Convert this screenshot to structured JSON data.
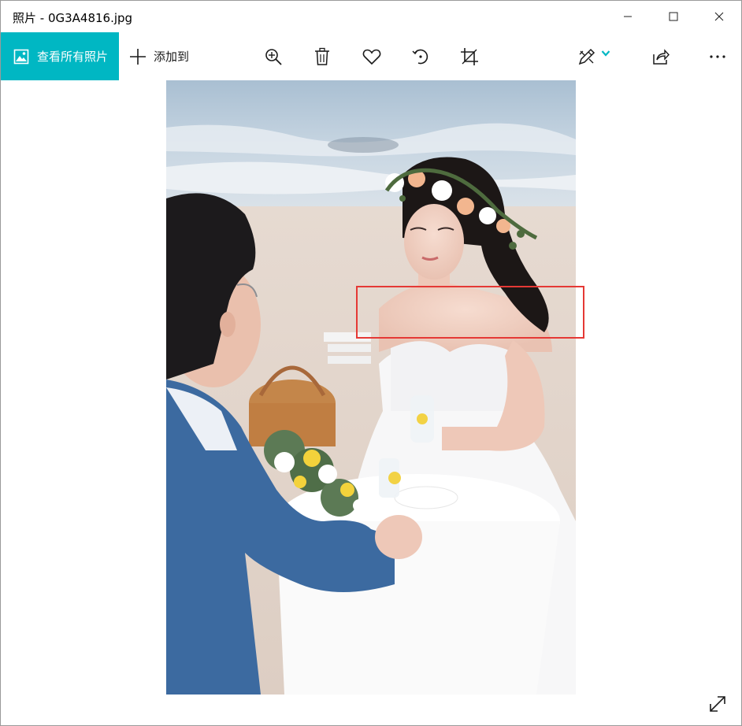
{
  "window": {
    "title": "照片 - 0G3A4816.jpg",
    "controls": [
      "minimize-icon",
      "maximize-icon",
      "close-icon"
    ]
  },
  "toolbar": {
    "view_all_label": "查看所有照片",
    "view_all_icon": "photo-gallery-icon",
    "add_to_label": "添加到",
    "add_to_icon": "plus-icon",
    "actions": [
      "zoom-in-icon",
      "delete-icon",
      "favorite-icon",
      "rotate-icon",
      "crop-icon",
      "edit-draw-icon",
      "share-icon",
      "more-icon"
    ],
    "accent_color": "#00b7c3"
  },
  "viewer": {
    "photo_alt_icon": "wedding-photo",
    "selection_box_color": "#e53935",
    "fullscreen_icon": "expand-icon"
  }
}
